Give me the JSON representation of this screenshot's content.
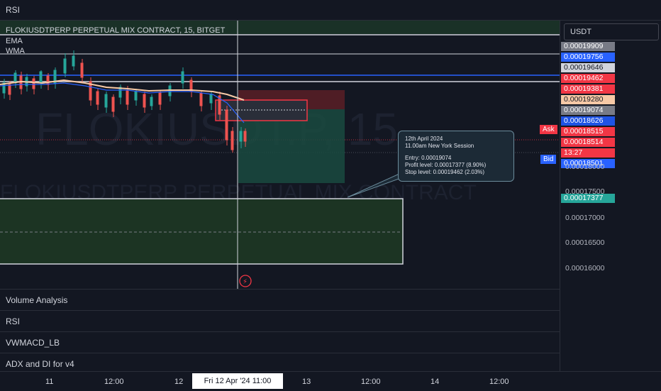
{
  "top_pane": {
    "label": "RSI"
  },
  "chart": {
    "symbol_title": "FLOKIUSDTPERP PERPETUAL MIX CONTRACT, 15, BITGET",
    "indicators": [
      "EMA",
      "WMA"
    ],
    "watermark_symbol": "FLOKIUSDT.P, 15",
    "watermark_desc": "FLOKIUSDTPERP PERPETUAL MIX CONTRACT"
  },
  "tooltip": {
    "date": "12th April 2024",
    "session": "11.00am New York Session",
    "entry": "Entry: 0.00019074",
    "profit": "Profit level: 0.00017377 (8.90%)",
    "stop": "Stop level: 0.00019462 (2.03%)"
  },
  "currency": "USDT",
  "price_labels": [
    {
      "text": "0.00019909",
      "color": "#787b86"
    },
    {
      "text": "0.00019756",
      "color": "#2962ff"
    },
    {
      "text": "0.00019646",
      "color": "#d1d4dc",
      "text_color": "#131722"
    },
    {
      "text": "0.00019462",
      "color": "#f23645"
    },
    {
      "text": "0.00019381",
      "color": "#f23645"
    },
    {
      "text": "0.00019280",
      "color": "#f7c9a6",
      "text_color": "#131722"
    },
    {
      "text": "0.00019074",
      "color": "#787b86"
    },
    {
      "text": "0.00018626",
      "color": "#1e53e5"
    },
    {
      "text": "0.00018515",
      "color": "#f23645"
    },
    {
      "text": "0.00018514",
      "color": "#f23645"
    },
    {
      "text": "13:27",
      "color": "#f23645"
    },
    {
      "text": "0.00018501",
      "color": "#2962ff"
    }
  ],
  "scale_labels": [
    "0.00018000",
    "0.00017500",
    "0.00017000",
    "0.00016500",
    "0.00016000"
  ],
  "target_label": "0.00017377",
  "ask_label": "Ask",
  "bid_label": "Bid",
  "panes": [
    "Volume Analysis",
    "RSI",
    "VWMACD_LB",
    "ADX and DI for v4"
  ],
  "time_axis": {
    "labels": [
      "11",
      "12:00",
      "12",
      "13",
      "12:00",
      "14",
      "12:00"
    ],
    "crosshair": "Fri 12 Apr '24   11:00"
  },
  "colors": {
    "background": "#131722",
    "up": "#26a69a",
    "down": "#ef5350",
    "ema": "#f7c9a6",
    "wma": "#2962ff"
  }
}
